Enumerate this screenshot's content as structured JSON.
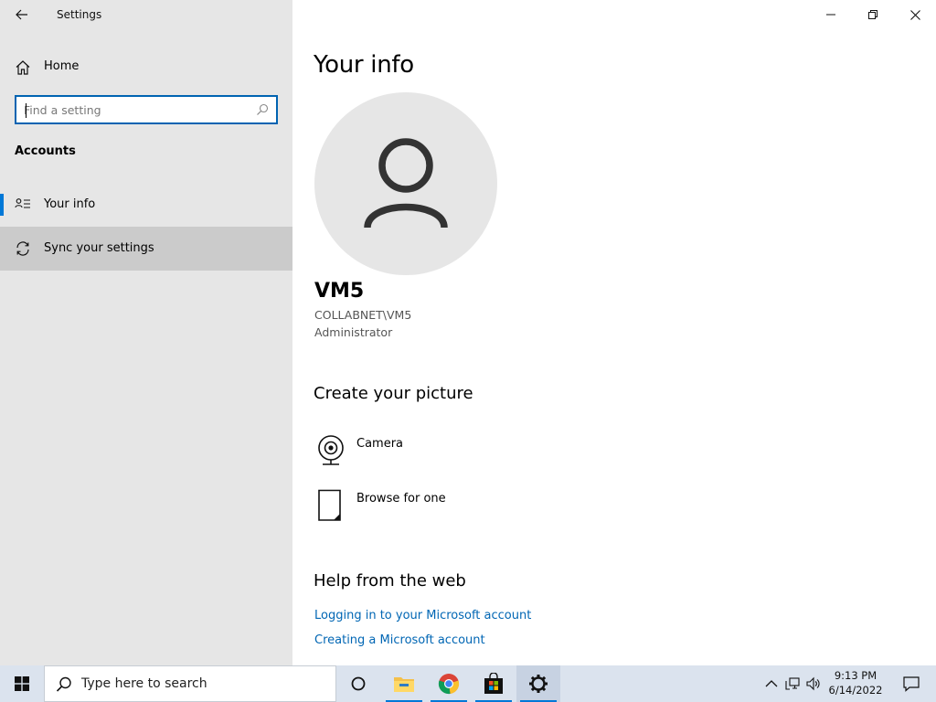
{
  "window": {
    "app_title": "Settings"
  },
  "sidebar": {
    "home_label": "Home",
    "search_placeholder": "Find a setting",
    "section_title": "Accounts",
    "items": [
      {
        "label": "Your info",
        "icon": "person-list-icon",
        "selected": true
      },
      {
        "label": "Sync your settings",
        "icon": "sync-icon",
        "selected": false
      }
    ]
  },
  "main": {
    "title": "Your info",
    "user": {
      "name": "VM5",
      "domain": "COLLABNET\\VM5",
      "role": "Administrator"
    },
    "create_picture": {
      "heading": "Create your picture",
      "options": [
        {
          "label": "Camera",
          "icon": "camera-icon"
        },
        {
          "label": "Browse for one",
          "icon": "file-icon"
        }
      ]
    },
    "help": {
      "heading": "Help from the web",
      "links": [
        "Logging in to your Microsoft account",
        "Creating a Microsoft account"
      ]
    }
  },
  "taskbar": {
    "search_placeholder": "Type here to search",
    "apps": [
      "task-view",
      "file-explorer",
      "chrome",
      "microsoft-store",
      "settings"
    ],
    "time": "9:13 PM",
    "date": "6/14/2022"
  },
  "colors": {
    "accent": "#0078d7",
    "link": "#0066b4",
    "sidebar_bg": "#e6e6e6",
    "taskbar_bg": "#dbe3ee"
  }
}
